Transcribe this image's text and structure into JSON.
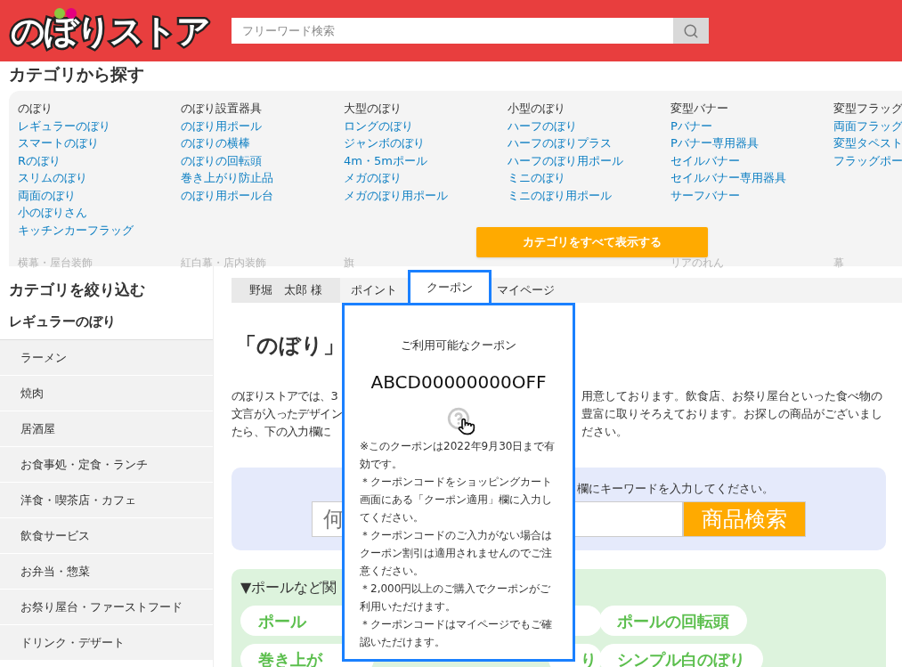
{
  "header": {
    "logo": "のぼりストア",
    "search": {
      "placeholder": "フリーワード検索"
    }
  },
  "category_browser": {
    "title": "カテゴリから探す",
    "button": "カテゴリをすべて表示する",
    "columns": [
      {
        "heading": "のぼり",
        "links": [
          "レギュラーのぼり",
          "スマートのぼり",
          "Rのぼり",
          "スリムのぼり",
          "両面のぼり",
          "小のぼりさん",
          "キッチンカーフラッグ"
        ],
        "faded_item": "横幕・屋台装飾"
      },
      {
        "heading": "のぼり設置器具",
        "links": [
          "のぼり用ポール",
          "のぼりの横棒",
          "のぼりの回転頭",
          "巻き上がり防止品",
          "のぼり用ポール台"
        ],
        "faded_item": "紅白幕・店内装飾"
      },
      {
        "heading": "大型のぼり",
        "links": [
          "ロングのぼり",
          "ジャンボのぼり",
          "4m・5mポール",
          "メガのぼり",
          "メガのぼり用ポール"
        ],
        "faded_item": "旗"
      },
      {
        "heading": "小型のぼり",
        "links": [
          "ハーフのぼり",
          "ハーフのぼりプラス",
          "ハーフのぼり用ポール",
          "ミニのぼり",
          "ミニのぼり用ポール"
        ]
      },
      {
        "heading": "変型バナー",
        "links": [
          "Pバナー",
          "Pバナー専用器具",
          "セイルバナー",
          "セイルバナー専用器具",
          "サーフバナー"
        ],
        "faded_item": "リアのれん"
      },
      {
        "heading": "変型フラッグ",
        "links": [
          "両面フラッグ",
          "変型タペスト",
          "フラッグポー"
        ],
        "faded_item": "幕"
      }
    ]
  },
  "sidebar": {
    "title": "カテゴリを絞り込む",
    "group": "レギュラーのぼり",
    "items": [
      "ラーメン",
      "焼肉",
      "居酒屋",
      "お食事処・定食・ランチ",
      "洋食・喫茶店・カフェ",
      "飲食サービス",
      "お弁当・惣菜",
      "お祭り屋台・ファーストフード",
      "ドリンク・デザート"
    ]
  },
  "user_name": "野堀　太郎 様",
  "tabs": [
    {
      "label": "ポイント",
      "selected": false
    },
    {
      "label": "クーポン",
      "selected": true
    },
    {
      "label": "マイページ",
      "selected": false
    }
  ],
  "page": {
    "heading": "「のぼり」",
    "intro_left": [
      "のぼりストアでは、3",
      "文言が入ったデザイン",
      "たら、下の入力欄に"
    ],
    "intro_right": [
      "用意しております。飲食店、お祭り屋台といった食べ物の",
      "豊富に取りそろえております。お探しの商品がございまし",
      "ださい。"
    ],
    "search_box": {
      "hint": "欄にキーワードを入力してください。",
      "input": {
        "placeholder": "何"
      },
      "button": "商品検索"
    },
    "related": {
      "title": "▼ポールなど関",
      "rows": [
        [
          {
            "kind": "left",
            "label": "ポール"
          },
          {
            "kind": "middle"
          },
          {
            "kind": "right",
            "label": "ポールの回転頭"
          }
        ],
        [
          {
            "kind": "left",
            "label": "巻き上が"
          },
          {
            "kind": "middle",
            "label": "り"
          },
          {
            "kind": "right",
            "label": "シンプル白のぼり"
          }
        ]
      ]
    }
  },
  "coupon_popover": {
    "title": "ご利用可能なクーポン",
    "code": "ABCD00000000OFF",
    "notes": [
      "※このクーポンは2022年9月30日まで有効です。",
      "＊クーポンコードをショッピングカート画面にある「クーポン適用」欄に入力してください。",
      "＊クーポンコードのご入力がない場合はクーポン割引は適用されませんのでご注意ください。",
      "＊2,000円以上のご購入でクーポンがご利用いただけます。",
      "＊クーポンコードはマイページでもご確認いただけます。"
    ]
  }
}
